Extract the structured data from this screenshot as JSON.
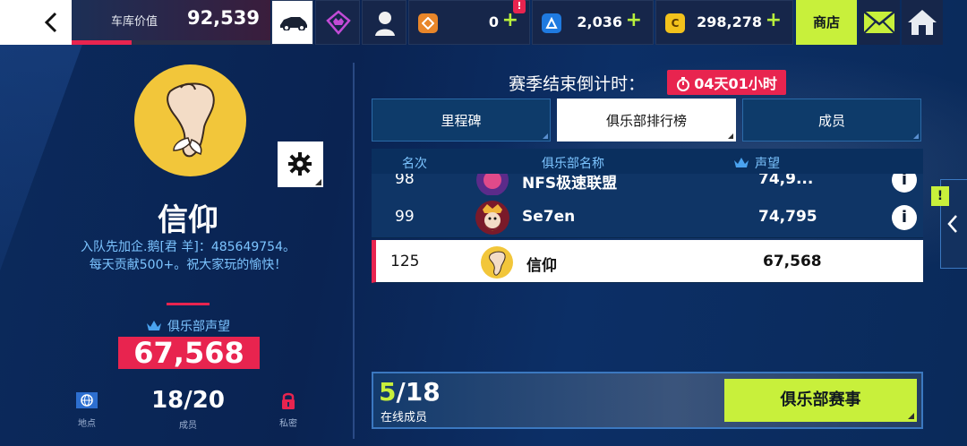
{
  "topbar": {
    "garage_label": "车库价值",
    "garage_value": "92,539",
    "garage_progress": 0.3,
    "currencies": [
      {
        "icon": "token-icon",
        "value": "0",
        "alert": "!"
      },
      {
        "icon": "credits-icon",
        "value": "2,036"
      },
      {
        "icon": "coin-icon",
        "value": "298,278"
      }
    ],
    "plus": "+",
    "shop_label": "商店"
  },
  "club": {
    "name": "信仰",
    "description_line1": "入队先加企.鹅[君 羊]：485649754。",
    "description_line2": "每天贡献500+。祝大家玩的愉快！",
    "reputation_label": "俱乐部声望",
    "reputation_value": "67,568",
    "members_count": "18/20",
    "members_label": "成员",
    "region_label": "地点",
    "privacy_label": "私密"
  },
  "season": {
    "title": "赛季结束倒计时：",
    "countdown": "04天01小时"
  },
  "tabs": [
    {
      "label": "里程碑",
      "active": false
    },
    {
      "label": "俱乐部排行榜",
      "active": true
    },
    {
      "label": "成员",
      "active": false
    }
  ],
  "leaderboard": {
    "headers": {
      "rank": "名次",
      "name": "俱乐部名称",
      "reputation": "声望"
    },
    "rows": [
      {
        "rank": "98",
        "name": "NFS极速联盟",
        "reputation": "74,9..."
      },
      {
        "rank": "99",
        "name": "Se7en",
        "reputation": "74,795"
      },
      {
        "rank": "125",
        "name": "信仰",
        "reputation": "67,568",
        "self": true
      }
    ]
  },
  "online": {
    "online_now": "5",
    "total": "/18",
    "label": "在线成员"
  },
  "event_button": "俱乐部赛事",
  "side_alert": "!",
  "info_glyph": "i",
  "colors": {
    "accent_red": "#e8244f",
    "accent_lime": "#c8f03b",
    "link_blue": "#7cc4ff"
  }
}
